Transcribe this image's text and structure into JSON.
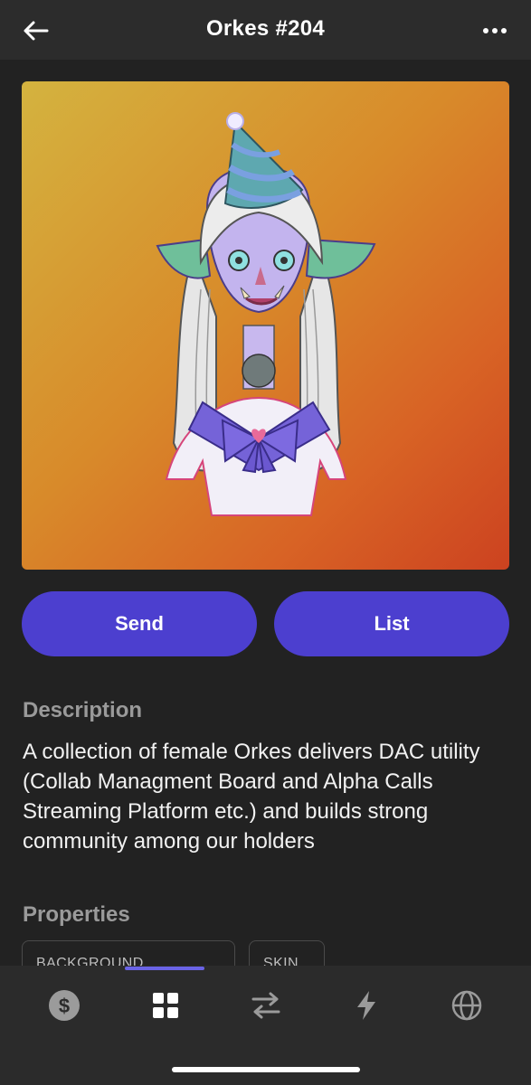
{
  "header": {
    "title": "Orkes #204",
    "back_icon": "arrow-left-icon",
    "more_icon": "more-horizontal-icon"
  },
  "nft": {
    "image_description_icon": "nft-artwork-image"
  },
  "actions": {
    "send_label": "Send",
    "list_label": "List"
  },
  "description": {
    "title": "Description",
    "text": "A collection of female Orkes delivers DAC utility (Collab Managment Board and Alpha Calls Streaming Platform etc.) and builds strong community among our holders"
  },
  "properties": {
    "title": "Properties",
    "items": [
      {
        "label": "BACKGROUND"
      },
      {
        "label": "SKIN"
      }
    ]
  },
  "tabbar": {
    "tabs": [
      {
        "name": "wallet",
        "icon": "dollar-icon",
        "active": false
      },
      {
        "name": "collectibles",
        "icon": "grid-icon",
        "active": true
      },
      {
        "name": "swap",
        "icon": "swap-icon",
        "active": false
      },
      {
        "name": "activity",
        "icon": "lightning-icon",
        "active": false
      },
      {
        "name": "explore",
        "icon": "globe-icon",
        "active": false
      }
    ]
  },
  "colors": {
    "accent": "#4c3fcf",
    "tab_indicator": "#6a63e6",
    "background": "#222222"
  }
}
